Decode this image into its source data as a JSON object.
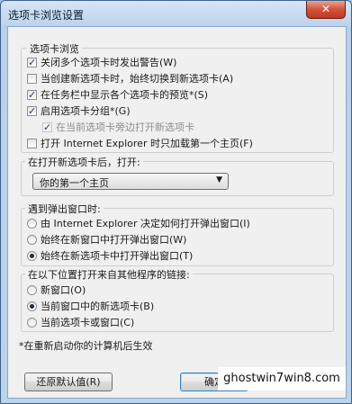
{
  "window": {
    "title": "选项卡浏览设置",
    "close_label": "✕"
  },
  "group1": {
    "title": "选项卡浏览",
    "options": [
      {
        "label": "关闭多个选项卡时发出警告(W)",
        "checked": true,
        "disabled": false
      },
      {
        "label": "当创建新选项卡时，始终切换到新选项卡(A)",
        "checked": false,
        "disabled": false
      },
      {
        "label": "在任务栏中显示各个选项卡的预览*(S)",
        "checked": true,
        "disabled": false
      },
      {
        "label": "启用选项卡分组*(G)",
        "checked": true,
        "disabled": false
      },
      {
        "label": "在当前选项卡旁边打开新选项卡",
        "checked": true,
        "disabled": true
      },
      {
        "label": "打开 Internet Explorer 时只加载第一个主页(F)",
        "checked": false,
        "disabled": false
      }
    ]
  },
  "group2": {
    "title": "在打开新选项卡后，打开:",
    "select_value": "你的第一个主页"
  },
  "group3": {
    "title": "遇到弹出窗口时:",
    "options": [
      {
        "label": "由 Internet Explorer 决定如何打开弹出窗口(I)",
        "checked": false
      },
      {
        "label": "始终在新窗口中打开弹出窗口(W)",
        "checked": false
      },
      {
        "label": "始终在新选项卡中打开弹出窗口(T)",
        "checked": true
      }
    ]
  },
  "group4": {
    "title": "在以下位置打开来自其他程序的链接:",
    "options": [
      {
        "label": "新窗口(O)",
        "checked": false
      },
      {
        "label": "当前窗口中的新选项卡(B)",
        "checked": true
      },
      {
        "label": "当前选项卡或窗口(C)",
        "checked": false
      }
    ]
  },
  "note": "*在重新启动你的计算机后生效",
  "buttons": {
    "restore": "还原默认值(R)",
    "ok": "确定"
  },
  "watermark": "ghostwin7win8.com"
}
